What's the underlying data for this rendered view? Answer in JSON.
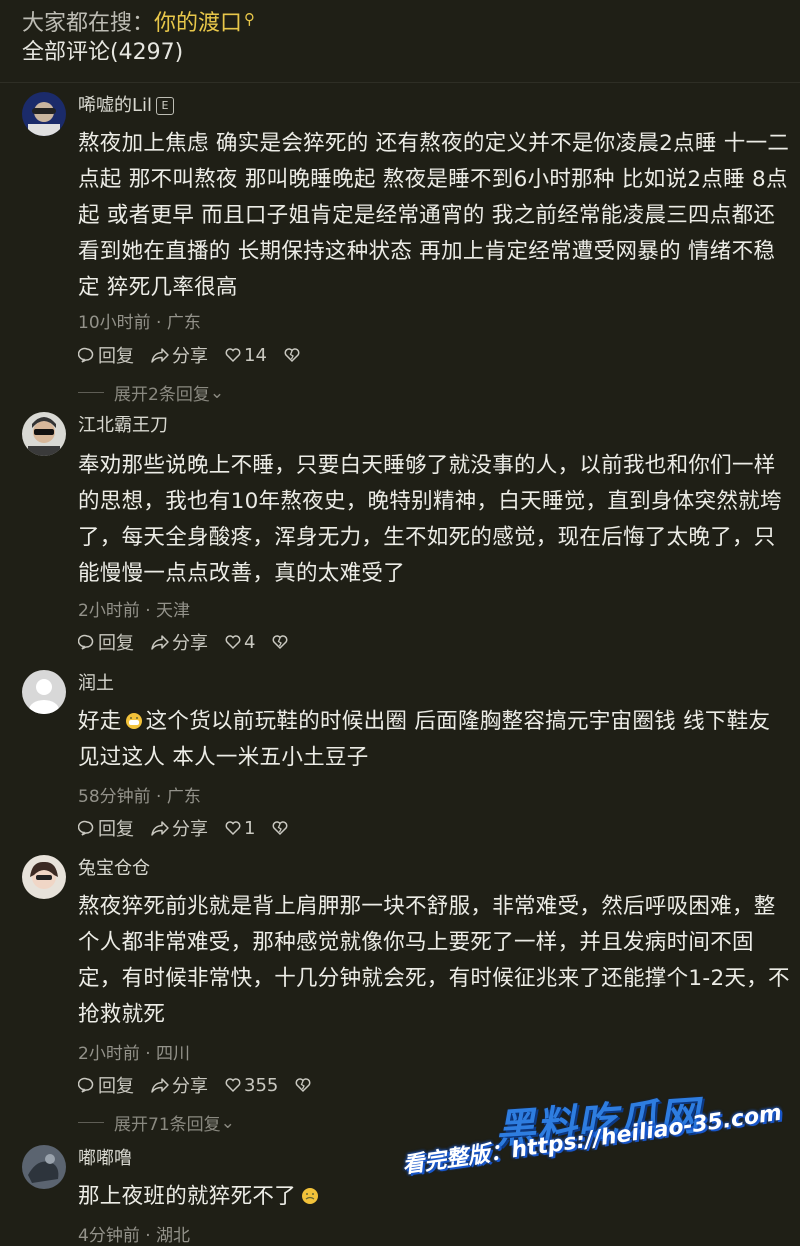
{
  "search": {
    "prefix": "大家都在搜：",
    "term": "你的渡口"
  },
  "comments_count": "全部评论(4297)",
  "actions": {
    "reply": "回复",
    "share": "分享"
  },
  "comments": [
    {
      "username": "唏嘘的Lil",
      "badge": "E",
      "text": "熬夜加上焦虑 确实是会猝死的 还有熬夜的定义并不是你凌晨2点睡 十一二点起 那不叫熬夜 那叫晚睡晚起 熬夜是睡不到6小时那种 比如说2点睡 8点起 或者更早 而且口子姐肯定是经常通宵的 我之前经常能凌晨三四点都还看到她在直播的 长期保持这种状态 再加上肯定经常遭受网暴的 情绪不稳定 猝死几率很高",
      "meta": "10小时前 · 广东",
      "likes": "14",
      "expand": "展开2条回复"
    },
    {
      "username": "江北霸王刀",
      "text": "奉劝那些说晚上不睡，只要白天睡够了就没事的人，以前我也和你们一样的思想，我也有10年熬夜史，晚特别精神，白天睡觉，直到身体突然就垮了，每天全身酸疼，浑身无力，生不如死的感觉，现在后悔了太晚了，只能慢慢一点点改善，真的太难受了",
      "meta": "2小时前 · 天津",
      "likes": "4"
    },
    {
      "username": "润土",
      "text_before": "好走",
      "text_after": "这个货以前玩鞋的时候出圈 后面隆胸整容搞元宇宙圈钱 线下鞋友见过这人 本人一米五小土豆子",
      "meta": "58分钟前 · 广东",
      "likes": "1"
    },
    {
      "username": "兔宝仓仓",
      "text": "熬夜猝死前兆就是背上肩胛那一块不舒服，非常难受，然后呼吸困难，整个人都非常难受，那种感觉就像你马上要死了一样，并且发病时间不固定，有时候非常快，十几分钟就会死，有时候征兆来了还能撑个1-2天，不抢救就死",
      "meta": "2小时前 · 四川",
      "likes": "355",
      "expand": "展开71条回复"
    },
    {
      "username": "嘟嘟噜",
      "text": "那上夜班的就猝死不了",
      "meta": "4分钟前 · 湖北"
    }
  ],
  "watermark": {
    "title": "黑料吃瓜网",
    "line": "看完整版：https://heiliao-35.com"
  },
  "colors": {
    "background": "#1f1f16",
    "accent": "#e8c74a",
    "watermark": "#2e7de0"
  }
}
